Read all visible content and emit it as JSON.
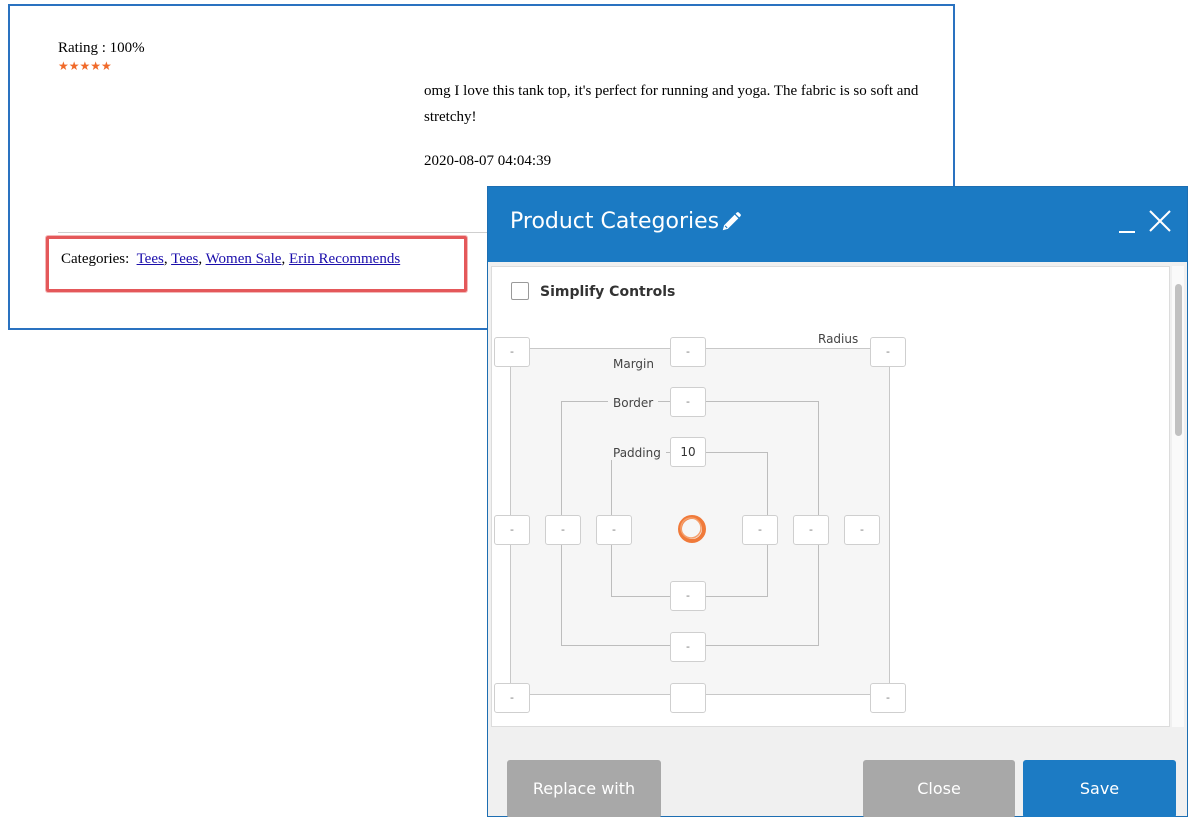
{
  "review": {
    "rating_text": "Rating : 100%",
    "stars": "★★★★★",
    "body": "omg I love this tank top, it's perfect for running and yoga. The fabric is so soft and stretchy!",
    "date": "2020-08-07 04:04:39"
  },
  "categories": {
    "label": "Categories:",
    "links": [
      "Tees",
      "Tees",
      "Women Sale",
      "Erin Recommends"
    ],
    "separator": ", "
  },
  "modal": {
    "title": "Product Categories",
    "minimize_symbol": "_",
    "simplify_controls_label": "Simplify Controls",
    "simplify_controls_checked": false,
    "box_model": {
      "margin_label": "Margin",
      "border_label": "Border",
      "padding_label": "Padding",
      "radius_label": "Radius",
      "empty_symbol": "-",
      "padding_top_value": "10"
    },
    "buttons": {
      "replace": "Replace with",
      "close": "Close",
      "save": "Save"
    }
  },
  "colors": {
    "header_blue": "#1b7ac3",
    "highlight_red": "#e4585a",
    "star_orange": "#f06a2a",
    "link_blue": "#1a0dab"
  },
  "icons": [
    "pencil-icon",
    "minimize-icon",
    "close-x-icon",
    "ring-icon"
  ]
}
